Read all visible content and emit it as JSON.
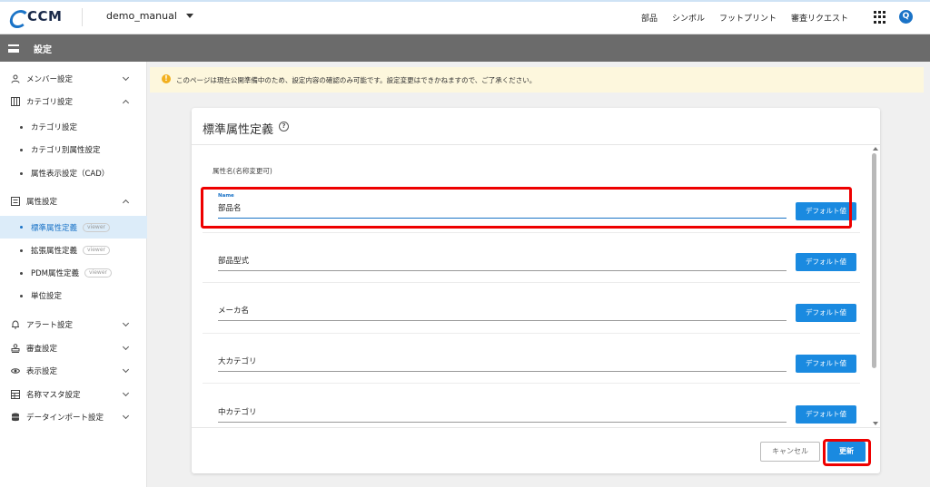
{
  "header": {
    "brand": "CCM",
    "project": "demo_manual",
    "nav": [
      "部品",
      "シンボル",
      "フットプリント",
      "審査リクエスト"
    ],
    "avatar_letter": "Q"
  },
  "subheader": {
    "title": "設定"
  },
  "sidebar": {
    "groups": [
      {
        "label": "メンバー設定",
        "icon": "user-icon",
        "expanded": false
      },
      {
        "label": "カテゴリ設定",
        "icon": "grid-icon",
        "expanded": true,
        "items": [
          "カテゴリ設定",
          "カテゴリ別属性設定",
          "属性表示設定（CAD）"
        ]
      },
      {
        "label": "属性設定",
        "icon": "list-icon",
        "expanded": true,
        "items": [
          {
            "label": "標準属性定義",
            "tag": "viewer",
            "active": true
          },
          {
            "label": "拡張属性定義",
            "tag": "viewer"
          },
          {
            "label": "PDM属性定義",
            "tag": "viewer"
          },
          {
            "label": "単位設定"
          }
        ]
      },
      {
        "label": "アラート設定",
        "icon": "bell-icon",
        "expanded": false
      },
      {
        "label": "審査設定",
        "icon": "stamp-icon",
        "expanded": false
      },
      {
        "label": "表示設定",
        "icon": "eye-icon",
        "expanded": false
      },
      {
        "label": "名称マスタ設定",
        "icon": "table-icon",
        "expanded": false
      },
      {
        "label": "データインポート設定",
        "icon": "database-icon",
        "expanded": false
      }
    ]
  },
  "notice": {
    "icon": "warning-icon",
    "color": "#f2b01e",
    "text": "このページは現在公開準備中のため、設定内容の確認のみ可能です。設定変更はできかねますので、ご了承ください。"
  },
  "card": {
    "title": "標準属性定義",
    "column_header": "属性名(名称変更可)",
    "rows": [
      {
        "float_label": "Name",
        "value": "部品名",
        "focused": true,
        "button": "デフォルト値"
      },
      {
        "value": "部品型式",
        "button": "デフォルト値"
      },
      {
        "value": "メーカ名",
        "button": "デフォルト値"
      },
      {
        "value": "大カテゴリ",
        "button": "デフォルト値"
      },
      {
        "value": "中カテゴリ",
        "button": "デフォルト値"
      }
    ],
    "cancel_label": "キャンセル",
    "update_label": "更新"
  },
  "colors": {
    "primary": "#1a8ae0",
    "highlight": "#e00000",
    "subbar": "#6b6b6b"
  }
}
